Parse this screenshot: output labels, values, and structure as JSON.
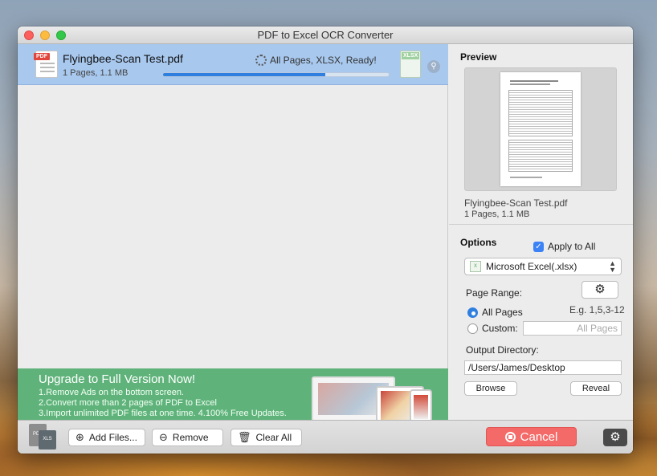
{
  "window": {
    "title": "PDF to Excel OCR Converter"
  },
  "file_list": {
    "items": [
      {
        "name": "Flyingbee-Scan Test.pdf",
        "meta": "1 Pages, 1.1 MB",
        "status": "All Pages, XLSX, Ready!",
        "progress_percent": 72,
        "source_icon": "pdf-file-icon",
        "target_icon": "xlsx-file-icon"
      }
    ]
  },
  "banner": {
    "title": "Upgrade to Full Version Now!",
    "lines": [
      "1.Remove Ads on the bottom screen.",
      "2.Convert more than 2 pages of PDF to Excel",
      "3.Import unlimited PDF files at one time. 4.100% Free Updates."
    ]
  },
  "preview": {
    "title": "Preview",
    "file_name": "Flyingbee-Scan Test.pdf",
    "file_meta": "1 Pages, 1.1 MB"
  },
  "options": {
    "title": "Options",
    "apply_to_all_label": "Apply to All",
    "apply_to_all_checked": true,
    "format_selected": "Microsoft Excel(.xlsx)",
    "page_range_label": "Page Range:",
    "all_pages_label": "All Pages",
    "range_hint": "E.g. 1,5,3-12",
    "custom_label": "Custom:",
    "custom_placeholder": "All Pages",
    "selected_range": "all",
    "output_dir_label": "Output Directory:",
    "output_dir_value": "/Users/James/Desktop",
    "browse_label": "Browse",
    "reveal_label": "Reveal"
  },
  "toolbar": {
    "add_files_label": "Add Files...",
    "remove_label": "Remove",
    "clear_all_label": "Clear All",
    "cancel_label": "Cancel",
    "logo_pdf_text": "PDF",
    "logo_xls_text": "XLS"
  },
  "colors": {
    "selected_row": "#a8c8ee",
    "banner_bg": "#5fb37a",
    "cancel_bg": "#f46a68",
    "accent_blue": "#2f7fe0"
  }
}
